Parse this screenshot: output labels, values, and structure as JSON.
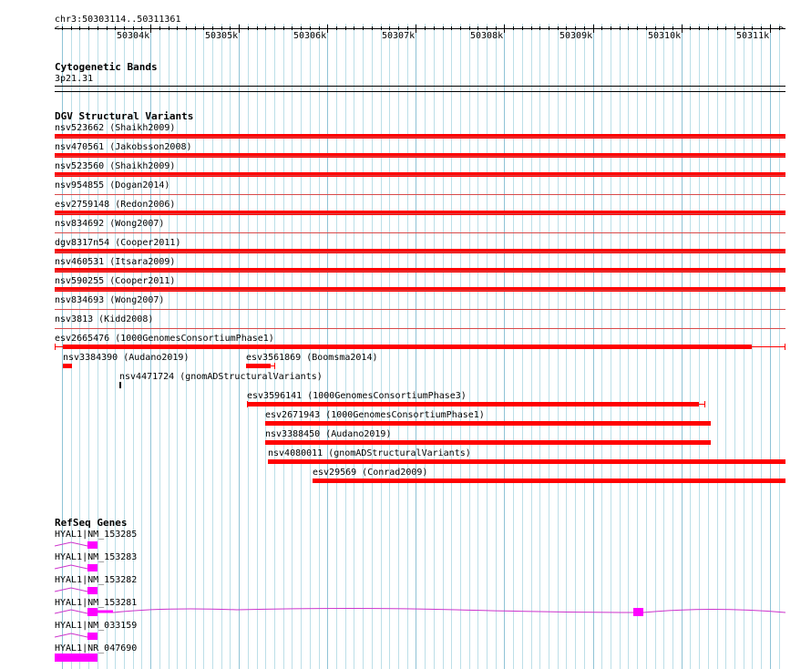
{
  "ruler": {
    "location": "chr3:50303114..50311361",
    "ticks": [
      "50304k",
      "50305k",
      "50306k",
      "50307k",
      "50308k",
      "50309k",
      "50310k",
      "50311k"
    ]
  },
  "cytoband": {
    "title": "Cytogenetic Bands",
    "band": "3p21.31"
  },
  "dgv": {
    "title": "DGV Structural Variants",
    "full_tracks": [
      "nsv523662 (Shaikh2009)",
      "nsv470561 (Jakobsson2008)",
      "nsv523560 (Shaikh2009)",
      "nsv954855 (Dogan2014)",
      "esv2759148 (Redon2006)",
      "nsv834692 (Wong2007)",
      "dgv8317n54 (Cooper2011)",
      "nsv460531 (Itsara2009)",
      "nsv590255 (Cooper2011)",
      "nsv834693 (Wong2007)",
      "nsv3813 (Kidd2008)",
      "esv2665476 (1000GenomesConsortiumPhase1)"
    ],
    "partial_tracks": [
      "nsv3384390 (Audano2019)",
      "esv3561869 (Boomsma2014)",
      "nsv4471724 (gnomADStructuralVariants)",
      "esv3596141 (1000GenomesConsortiumPhase3)",
      "esv2671943 (1000GenomesConsortiumPhase1)",
      "nsv3388450 (Audano2019)",
      "nsv4080011 (gnomADStructuralVariants)",
      "esv29569 (Conrad2009)"
    ]
  },
  "refseq": {
    "title": "RefSeq Genes",
    "genes": [
      "HYAL1|NM_153285",
      "HYAL1|NM_153283",
      "HYAL1|NM_153282",
      "HYAL1|NM_153281",
      "HYAL1|NM_033159",
      "HYAL1|NR_047690"
    ]
  },
  "colors": {
    "variant": "#ff0000",
    "exon": "#ff00ff",
    "intron": "#cc33cc",
    "grid": "#bcdfe8"
  }
}
